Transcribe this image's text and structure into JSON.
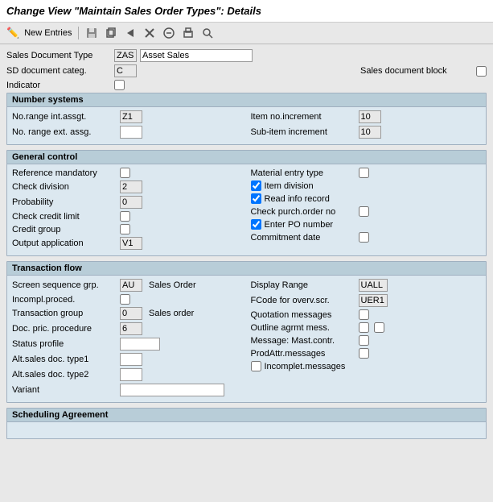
{
  "title": "Change View \"Maintain Sales Order Types\": Details",
  "toolbar": {
    "new_entries_label": "New Entries",
    "icons": [
      "edit-icon",
      "save-icon",
      "back-icon",
      "exit-icon",
      "cancel-icon",
      "print-icon",
      "find-icon"
    ]
  },
  "header": {
    "sales_doc_type_label": "Sales Document Type",
    "sales_doc_type_code": "ZAST",
    "sales_doc_type_name": "Asset Sales",
    "sd_doc_categ_label": "SD document categ.",
    "sd_doc_categ_value": "C",
    "sales_doc_block_label": "Sales document block",
    "indicator_label": "Indicator"
  },
  "number_systems": {
    "section_label": "Number systems",
    "no_range_int_label": "No.range int.assgt.",
    "no_range_int_value": "Z1",
    "no_range_ext_label": "No. range ext. assg.",
    "no_range_ext_value": "",
    "item_no_increment_label": "Item no.increment",
    "item_no_increment_value": "10",
    "sub_item_increment_label": "Sub-item increment",
    "sub_item_increment_value": "10"
  },
  "general_control": {
    "section_label": "General control",
    "ref_mandatory_label": "Reference mandatory",
    "check_division_label": "Check division",
    "check_division_value": "2",
    "probability_label": "Probability",
    "probability_value": "0",
    "check_credit_limit_label": "Check credit limit",
    "credit_group_label": "Credit group",
    "output_application_label": "Output application",
    "output_application_value": "V1",
    "material_entry_type_label": "Material entry type",
    "item_division_label": "Item division",
    "item_division_checked": true,
    "read_info_record_label": "Read info record",
    "read_info_record_checked": true,
    "check_purch_order_label": "Check purch.order no",
    "enter_po_number_label": "Enter PO number",
    "enter_po_number_checked": true,
    "commitment_date_label": "Commitment  date"
  },
  "transaction_flow": {
    "section_label": "Transaction flow",
    "screen_seq_grp_label": "Screen sequence grp.",
    "screen_seq_grp_value": "AU",
    "screen_seq_grp_text": "Sales Order",
    "incompl_proced_label": "Incompl.proced.",
    "transaction_group_label": "Transaction group",
    "transaction_group_value": "0",
    "transaction_group_text": "Sales order",
    "doc_pric_procedure_label": "Doc. pric. procedure",
    "doc_pric_procedure_value": "6",
    "status_profile_label": "Status profile",
    "alt_sales_doc_type1_label": "Alt.sales doc. type1",
    "alt_sales_doc_type2_label": "Alt.sales doc. type2",
    "variant_label": "Variant",
    "display_range_label": "Display Range",
    "display_range_value": "UALL",
    "fcode_overv_label": "FCode for overv.scr.",
    "fcode_overv_value": "UER1",
    "quotation_messages_label": "Quotation messages",
    "outline_agrmt_mess_label": "Outline agrmt mess.",
    "message_mast_contr_label": "Message: Mast.contr.",
    "prod_attr_messages_label": "ProdAttr.messages",
    "incomplet_messages_label": "Incomplet.messages"
  },
  "scheduling_agreement": {
    "section_label": "Scheduling Agreement"
  }
}
